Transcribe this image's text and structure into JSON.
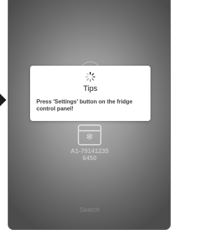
{
  "dialog": {
    "icon": "loading-spinner-icon",
    "title": "Tips",
    "message": "Press 'Settings' button on the fridge control panel!"
  },
  "device": {
    "icon": "fridge-icon",
    "name_line1": "A1-79141235",
    "name_line2": "6450"
  },
  "footer": {
    "search_label": "Search"
  },
  "colors": {
    "overlay": "#8a8a8a",
    "dialog_bg": "#ffffff",
    "text_dark": "#222222"
  }
}
